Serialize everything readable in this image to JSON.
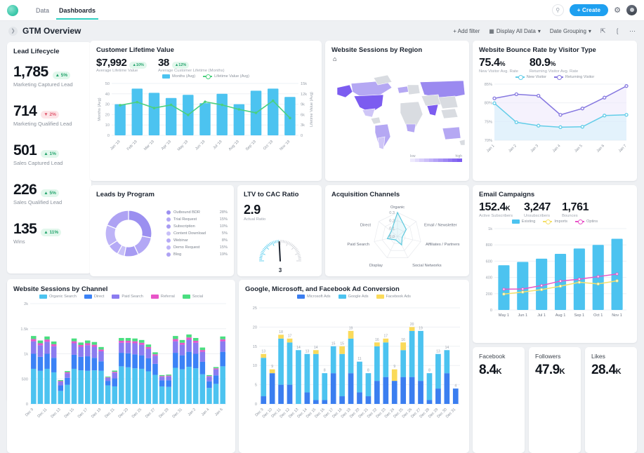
{
  "nav": {
    "tabs": [
      {
        "label": "Data",
        "active": false
      },
      {
        "label": "Dashboards",
        "active": true
      }
    ],
    "search_icon": "search-icon",
    "create_label": "+ Create",
    "gear_icon": "gear-icon",
    "avatar": "avatar"
  },
  "toolbar": {
    "title": "GTM Overview",
    "add_filter": "+ Add filter",
    "display": "Display All Data",
    "date_grouping": "Date Grouping",
    "expand_icon": "expand-icon",
    "share_icon": "share-icon",
    "more_icon": "more-icon"
  },
  "lead_lifecycle": {
    "title": "Lead Lifecycle",
    "items": [
      {
        "value": "1,785",
        "delta": "5%",
        "dir": "up",
        "label": "Marketing Captured Lead"
      },
      {
        "value": "714",
        "delta": "2%",
        "dir": "down",
        "label": "Marketing Qualified Lead"
      },
      {
        "value": "501",
        "delta": "1%",
        "dir": "up",
        "label": "Sales Captured Lead"
      },
      {
        "value": "226",
        "delta": "5%",
        "dir": "up",
        "label": "Sales Qualified Lead"
      },
      {
        "value": "135",
        "delta": "11%",
        "dir": "up",
        "label": "Wins"
      }
    ]
  },
  "clv": {
    "title": "Customer Lifetime Value",
    "stats": [
      {
        "value": "$7,992",
        "delta": "10%",
        "dir": "up",
        "sub": "Average Lifetime Value"
      },
      {
        "value": "38",
        "delta": "12%",
        "dir": "up",
        "sub": "Average Customer Lifetime (Months)"
      }
    ],
    "chart_data": {
      "type": "bar",
      "title": "Customer Lifetime Value",
      "categories": [
        "Jan '19",
        "Feb '19",
        "Mar '19",
        "Apr '19",
        "May '19",
        "Jun '19",
        "Jul '19",
        "Aug '19",
        "Sep '19",
        "Oct '19",
        "Nov '19"
      ],
      "series": [
        {
          "name": "Months (Avg)",
          "type": "bar",
          "color": "#4cc3f0",
          "values": [
            30,
            45,
            41,
            36,
            39,
            31,
            40,
            30,
            43,
            45,
            37
          ]
        },
        {
          "name": "Lifetime Value (Avg)",
          "type": "line",
          "color": "#4bd07e",
          "values": [
            8700,
            9600,
            7900,
            8800,
            5900,
            9700,
            8800,
            7500,
            6500,
            10000,
            5000
          ]
        }
      ],
      "ylabel": "Months (Avg)",
      "y2label": "Lifetime Value (Avg)",
      "ylim": [
        0,
        50
      ],
      "y2lim": [
        0,
        15000
      ],
      "yticks": [
        0,
        10,
        20,
        30,
        40,
        50
      ],
      "y2ticks": [
        "0",
        "3k",
        "6k",
        "9k",
        "12k",
        "15k"
      ],
      "grid": true,
      "legend": "top"
    }
  },
  "sessions_region": {
    "title": "Website Sessions by Region",
    "home_icon": "home-icon",
    "legend_low": "low",
    "legend_high": "high",
    "chart_data": {
      "type": "heatmap",
      "title": "Website Sessions by Region",
      "scale_labels": [
        "low",
        "high"
      ],
      "colors": [
        "#ece9fb",
        "#7c5cf0"
      ],
      "regions": [
        {
          "name": "United States",
          "intensity": 1.0
        },
        {
          "name": "Canada",
          "intensity": 0.45
        },
        {
          "name": "Alaska",
          "intensity": 0.8
        },
        {
          "name": "Brazil",
          "intensity": 0.55
        },
        {
          "name": "Russia",
          "intensity": 0.6
        },
        {
          "name": "India",
          "intensity": 0.75
        },
        {
          "name": "Australia",
          "intensity": 0.55
        },
        {
          "name": "United Kingdom",
          "intensity": 0.5
        },
        {
          "name": "South Africa",
          "intensity": 0.5
        }
      ]
    }
  },
  "bounce": {
    "title": "Website Bounce Rate by Visitor Type",
    "stats": [
      {
        "value": "75.4",
        "unit": "%",
        "sub": "New Visitor Avg. Rate"
      },
      {
        "value": "80.9",
        "unit": "%",
        "sub": "Returning Visitor Avg. Rate"
      }
    ],
    "chart_data": {
      "type": "line",
      "title": "Website Bounce Rate by Visitor Type",
      "categories": [
        "Jan 1",
        "Jan 2",
        "Jan 3",
        "Jan 4",
        "Jan 5",
        "Jan 6",
        "Jan 7"
      ],
      "series": [
        {
          "name": "New Visitor",
          "color": "#62cde8",
          "values": [
            79.9,
            74.8,
            73.9,
            73.5,
            73.6,
            76.6,
            76.8
          ]
        },
        {
          "name": "Returning Visitor",
          "color": "#8678e0",
          "values": [
            81.2,
            82.3,
            81.9,
            76.8,
            78.5,
            81.4,
            84.5
          ]
        }
      ],
      "ylim": [
        70,
        85
      ],
      "yticks": [
        "70%",
        "75%",
        "80%",
        "85%"
      ],
      "grid": true,
      "legend": "top"
    }
  },
  "leads_program": {
    "title": "Leads by Program",
    "chart_data": {
      "type": "pie",
      "title": "Leads by Program",
      "labels": [
        "Outbound BDR",
        "Trial Request",
        "Subscription",
        "Content Download",
        "Webinar",
        "Demo Request",
        "Blog"
      ],
      "values": [
        28,
        15,
        10,
        5,
        8,
        15,
        19
      ],
      "display_values": [
        "28%",
        "15%",
        "10%",
        "5%",
        "8%",
        "15%",
        "19%"
      ],
      "colors": [
        "#9b8ff0",
        "#b3a8f5",
        "#a79bf2",
        "#c8c0f8",
        "#b5aaf6",
        "#beb4f7",
        "#aea2f3"
      ],
      "legend": "right"
    }
  },
  "ltv_cac": {
    "title": "LTV to CAC Ratio",
    "value": "2.9",
    "sub": "Actual Ratio",
    "gauge_label": "3",
    "chart_data": {
      "type": "gauge",
      "title": "LTV to CAC Ratio",
      "value": 2.9,
      "target": 3,
      "min": 0,
      "max": 6,
      "colors": [
        "#45c7ec",
        "#c9ccd2"
      ]
    }
  },
  "acquisition": {
    "title": "Acquisition Channels",
    "chart_data": {
      "type": "radar",
      "title": "Acquisition Channels",
      "axes": [
        "Organic",
        "Email / Newsletter",
        "Affiliates / Partners",
        "Social Networks",
        "Display",
        "Paid Search",
        "Direct"
      ],
      "values": [
        0.3,
        0.14,
        0.06,
        0.12,
        0.05,
        0.13,
        0.1
      ],
      "rticks": [
        "0.0",
        "0.1",
        "0.2",
        "0.3"
      ],
      "rlim": [
        0,
        0.3
      ],
      "color": "#5bc8dd"
    }
  },
  "email": {
    "title": "Email Campaigns",
    "stats": [
      {
        "value": "152.4",
        "unit": "K",
        "sub": "Active Subscribers"
      },
      {
        "value": "3,247",
        "unit": "",
        "sub": "Unsubscribers"
      },
      {
        "value": "1,761",
        "unit": "",
        "sub": "Bounces"
      }
    ],
    "chart_data": {
      "type": "bar",
      "title": "Email Campaigns",
      "categories": [
        "May 1",
        "Jun 1",
        "Jul 1",
        "Aug 1",
        "Sep 1",
        "Oct 1",
        "Nov 1"
      ],
      "series": [
        {
          "name": "Existing",
          "type": "bar",
          "color": "#4cc3f0",
          "values": [
            550,
            590,
            630,
            690,
            755,
            800,
            875
          ]
        },
        {
          "name": "Imports",
          "type": "line",
          "color": "#f5e06a",
          "values": [
            195,
            220,
            250,
            292,
            340,
            320,
            358
          ]
        },
        {
          "name": "Optins",
          "type": "line",
          "color": "#e855c8",
          "values": [
            255,
            258,
            300,
            355,
            378,
            410,
            442
          ]
        }
      ],
      "ylim": [
        0,
        1000
      ],
      "yticks": [
        "0",
        "200",
        "400",
        "600",
        "800",
        "1k"
      ],
      "grid": true,
      "legend": "top"
    }
  },
  "sessions_channel": {
    "title": "Website Sessions by Channel",
    "chart_data": {
      "type": "bar",
      "title": "Website Sessions by Channel",
      "stacked": true,
      "categories": [
        "Dec 9",
        "Dec 10",
        "Dec 11",
        "Dec 12",
        "Dec 13",
        "Dec 14",
        "Dec 15",
        "Dec 16",
        "Dec 17",
        "Dec 18",
        "Dec 19",
        "Dec 20",
        "Dec 21",
        "Dec 22",
        "Dec 23",
        "Dec 24",
        "Dec 25",
        "Dec 26",
        "Dec 27",
        "Dec 28",
        "Dec 29",
        "Dec 30",
        "Dec 31",
        "Jan 1",
        "Jan 2",
        "Jan 3",
        "Jan 4",
        "Jan 5",
        "Jan 6"
      ],
      "tick_labels": [
        "Dec 9",
        "Dec 11",
        "Dec 13",
        "Dec 15",
        "Dec 17",
        "Dec 19",
        "Dec 21",
        "Dec 23",
        "Dec 25",
        "Dec 27",
        "Dec 29",
        "Dec 31",
        "Jan 2",
        "Jan 4",
        "Jan 6"
      ],
      "series": [
        {
          "name": "Organic Search",
          "color": "#4cc3f0",
          "values": [
            700,
            660,
            700,
            630,
            260,
            380,
            700,
            670,
            660,
            670,
            660,
            370,
            350,
            750,
            730,
            710,
            700,
            650,
            580,
            350,
            340,
            720,
            690,
            740,
            710,
            590,
            320,
            400,
            750
          ]
        },
        {
          "name": "Direct",
          "color": "#3b82f6",
          "values": [
            300,
            280,
            300,
            290,
            110,
            140,
            280,
            270,
            290,
            250,
            190,
            90,
            160,
            270,
            280,
            280,
            270,
            260,
            220,
            120,
            130,
            300,
            280,
            300,
            290,
            250,
            130,
            170,
            290
          ]
        },
        {
          "name": "Paid Search",
          "color": "#8b7cf0",
          "values": [
            250,
            230,
            240,
            230,
            70,
            90,
            230,
            200,
            220,
            220,
            200,
            60,
            110,
            200,
            210,
            220,
            210,
            190,
            160,
            70,
            80,
            230,
            210,
            240,
            220,
            200,
            90,
            120,
            210
          ]
        },
        {
          "name": "Referral",
          "color": "#e855c8",
          "values": [
            45,
            40,
            45,
            40,
            15,
            20,
            40,
            35,
            40,
            40,
            35,
            10,
            20,
            40,
            40,
            40,
            40,
            35,
            30,
            15,
            15,
            45,
            40,
            45,
            40,
            35,
            15,
            20,
            40
          ]
        },
        {
          "name": "Social",
          "color": "#4ade80",
          "values": [
            60,
            55,
            60,
            55,
            20,
            25,
            55,
            50,
            55,
            55,
            50,
            15,
            25,
            55,
            55,
            55,
            55,
            50,
            40,
            20,
            20,
            60,
            55,
            60,
            55,
            50,
            20,
            25,
            55
          ]
        }
      ],
      "ylim": [
        0,
        2000
      ],
      "yticks": [
        "0",
        "500",
        "1k",
        "1.5k",
        "2k"
      ],
      "grid": true,
      "legend": "top"
    }
  },
  "ad_conversion": {
    "title": "Google, Microsoft, and Facebook Ad Conversion",
    "chart_data": {
      "type": "bar",
      "title": "Google, Microsoft, and Facebook Ad Conversion",
      "stacked": true,
      "categories": [
        "Dec 9",
        "Dec 10",
        "Dec 11",
        "Dec 12",
        "Dec 13",
        "Dec 14",
        "Dec 15",
        "Dec 16",
        "Dec 17",
        "Dec 18",
        "Dec 19",
        "Dec 20",
        "Dec 21",
        "Dec 22",
        "Dec 23",
        "Dec 24",
        "Dec 25",
        "Dec 26",
        "Dec 27",
        "Dec 28",
        "Dec 29",
        "Dec 30",
        "Dec 31"
      ],
      "totals": [
        13,
        9,
        18,
        17,
        14,
        13,
        14,
        8,
        15,
        15,
        19,
        11,
        8,
        16,
        17,
        9,
        16,
        20,
        19,
        8,
        13,
        14,
        4
      ],
      "series": [
        {
          "name": "Microsoft Ads",
          "color": "#3b7ef0",
          "values": [
            2,
            8,
            5,
            5,
            0,
            3,
            1,
            1,
            8,
            2,
            8,
            3,
            2,
            6,
            7,
            6,
            7,
            7,
            6,
            1,
            4,
            8,
            4
          ]
        },
        {
          "name": "Google Ads",
          "color": "#4cc3f0",
          "values": [
            10,
            0,
            12,
            11,
            14,
            10,
            12,
            7,
            7,
            11,
            9,
            8,
            6,
            9,
            9,
            0,
            7,
            12,
            13,
            7,
            9,
            6,
            0
          ]
        },
        {
          "name": "Facebook Ads",
          "color": "#fada5a",
          "values": [
            1,
            1,
            1,
            1,
            0,
            0,
            1,
            0,
            0,
            2,
            2,
            0,
            0,
            1,
            1,
            3,
            2,
            1,
            0,
            0,
            0,
            0,
            0
          ]
        }
      ],
      "ylim": [
        0,
        25
      ],
      "yticks": [
        "0",
        "5",
        "10",
        "15",
        "20",
        "25"
      ],
      "grid": true,
      "legend": "top"
    }
  },
  "social_stats": [
    {
      "title": "Facebook",
      "value": "8.4",
      "unit": "K"
    },
    {
      "title": "Followers",
      "value": "47.9",
      "unit": "K"
    },
    {
      "title": "Likes",
      "value": "28.4",
      "unit": "K"
    }
  ]
}
